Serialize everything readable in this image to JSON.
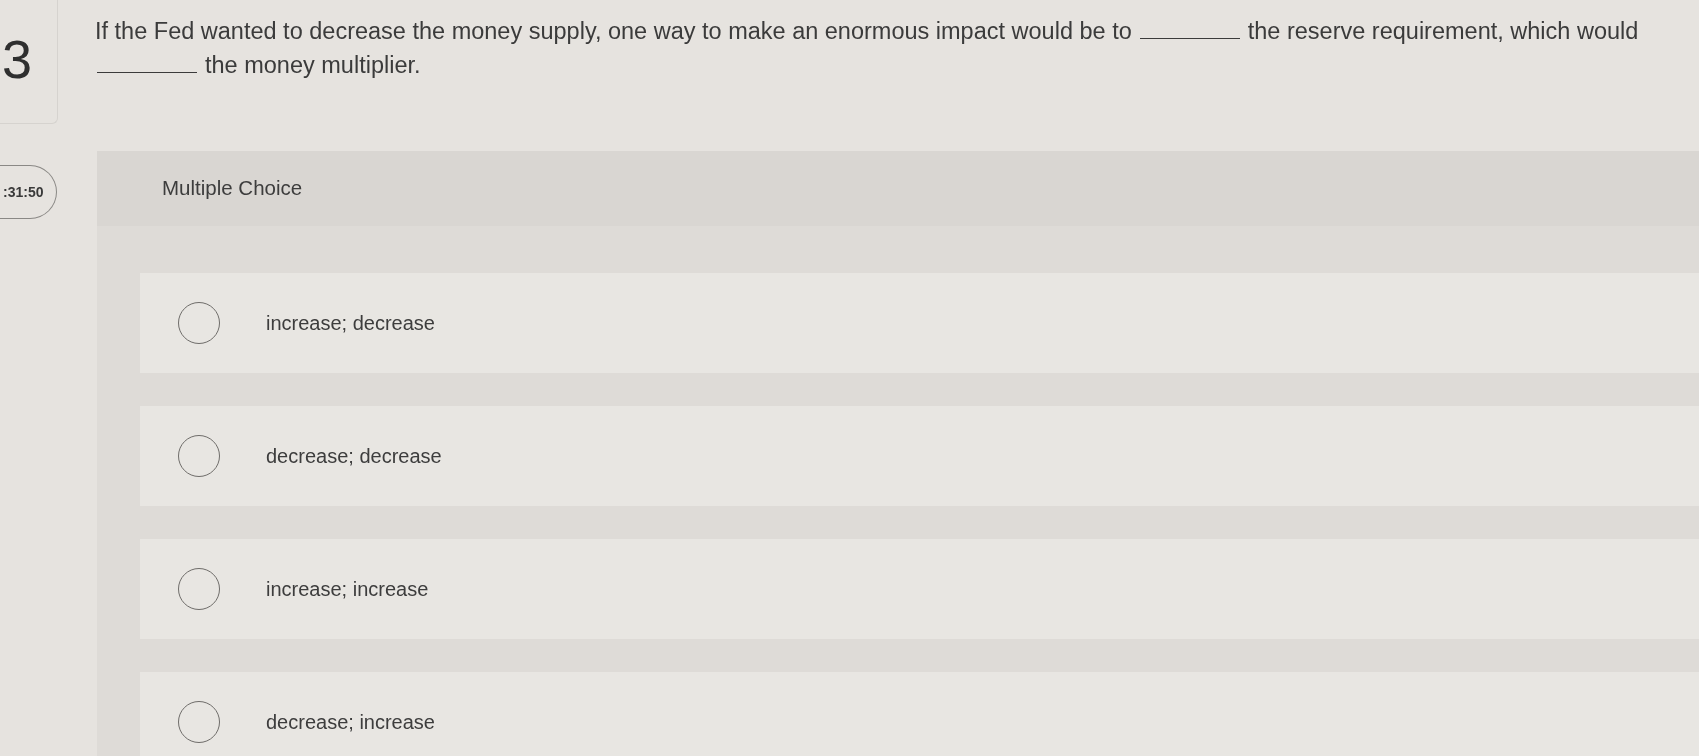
{
  "question_number": "3",
  "timer": ":31:50",
  "question": {
    "segments": [
      {
        "kind": "text",
        "text": "If the Fed wanted to decrease the money supply, one way to make an enormous impact would be to"
      },
      {
        "kind": "blank"
      },
      {
        "kind": "text",
        "text": "the reserve requirement, which would"
      },
      {
        "kind": "blank"
      },
      {
        "kind": "text",
        "text": "the money multiplier."
      }
    ]
  },
  "multiple_choice": {
    "heading": "Multiple Choice",
    "options": [
      {
        "label": "increase; decrease",
        "selected": false
      },
      {
        "label": "decrease; decrease",
        "selected": false
      },
      {
        "label": "increase; increase",
        "selected": false
      },
      {
        "label": "decrease; increase",
        "selected": false
      }
    ]
  }
}
